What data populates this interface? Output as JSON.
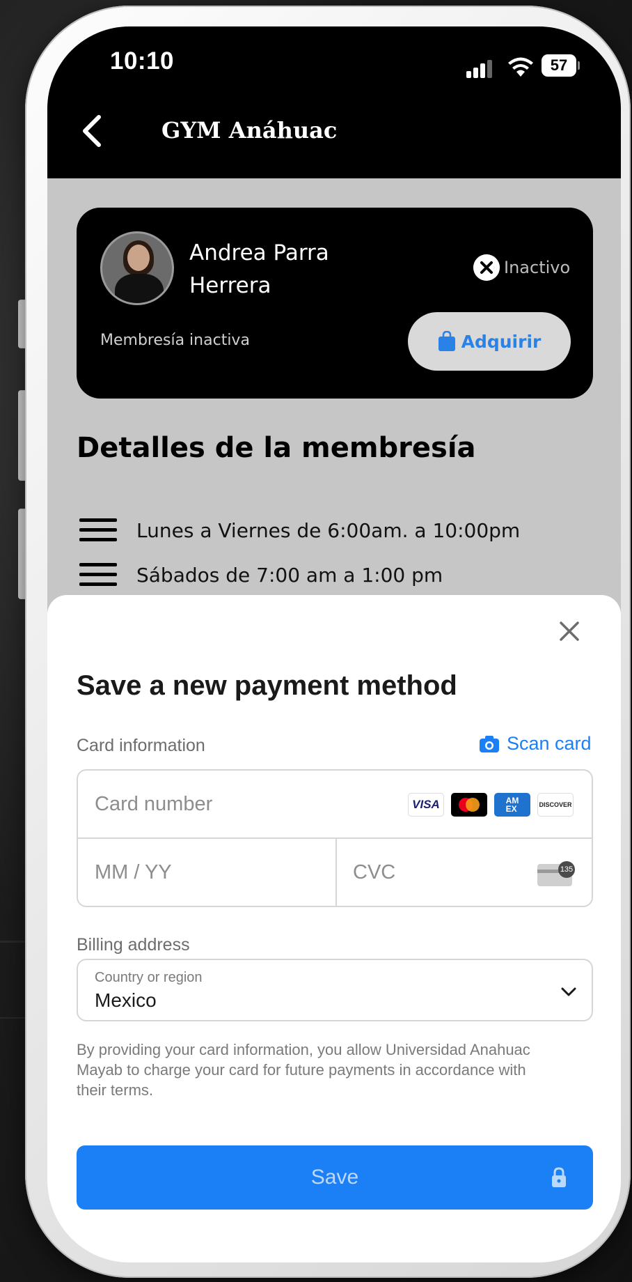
{
  "status_bar": {
    "time": "10:10",
    "battery": "57"
  },
  "header": {
    "title": "GYM Anáhuac"
  },
  "member": {
    "name": "Andrea Parra Herrera",
    "status": "Inactivo",
    "membership_status": "Membresía inactiva",
    "acquire_label": "Adquirir"
  },
  "details": {
    "title": "Detalles de la membresía",
    "schedule": [
      "Lunes a Viernes de 6:00am. a 10:00pm",
      "Sábados de 7:00 am a 1:00 pm"
    ]
  },
  "payment_sheet": {
    "title": "Save a new payment method",
    "card_info_label": "Card information",
    "scan_card_label": "Scan card",
    "card_number_placeholder": "Card number",
    "expiry_placeholder": "MM / YY",
    "cvc_placeholder": "CVC",
    "card_brands": [
      "VISA",
      "Mastercard",
      "AMEX",
      "DISCOVER"
    ],
    "cvc_hint": "135",
    "billing_label": "Billing address",
    "country_label": "Country or region",
    "country_value": "Mexico",
    "disclaimer": "By providing your card information, you allow Universidad Anahuac Mayab to charge your card for future payments in accordance with their terms.",
    "save_label": "Save"
  },
  "colors": {
    "accent": "#1b7ff5",
    "header_bg": "#000000",
    "page_bg": "#c6c6c6"
  }
}
